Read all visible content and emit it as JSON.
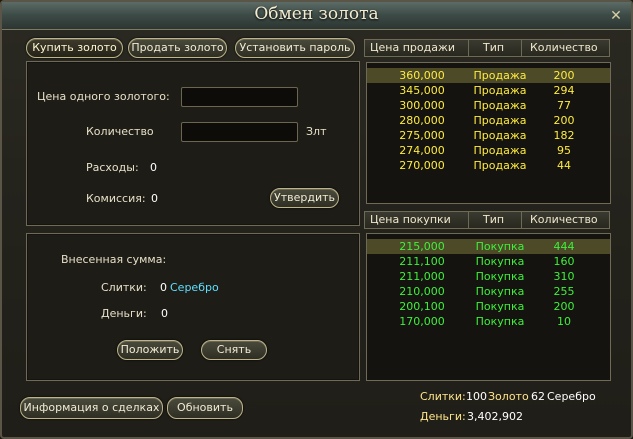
{
  "window": {
    "title": "Обмен золота",
    "close": "✕"
  },
  "tabs": {
    "buy": "Купить золото",
    "sell": "Продать золото",
    "password": "Установить пароль"
  },
  "form": {
    "price_label": "Цена одного золотого:",
    "quantity_label": "Количество",
    "quantity_unit": "Злт",
    "expense_label": "Расходы:",
    "expense_value": "0",
    "commission_label": "Комиссия:",
    "commission_value": "0",
    "confirm_button": "Утвердить"
  },
  "deposit": {
    "title": "Внесенная сумма:",
    "ingots_label": "Слитки:",
    "ingots_value": "0",
    "ingots_unit": "Серебро",
    "money_label": "Деньги:",
    "money_value": "0",
    "put_button": "Положить",
    "take_button": "Снять"
  },
  "bottom_buttons": {
    "deals_info": "Информация о сделках",
    "refresh": "Обновить"
  },
  "sell_table": {
    "headers": {
      "price": "Цена продажи",
      "type": "Тип",
      "qty": "Количество"
    },
    "rows": [
      {
        "price": "360,000",
        "type": "Продажа",
        "qty": "200"
      },
      {
        "price": "345,000",
        "type": "Продажа",
        "qty": "294"
      },
      {
        "price": "300,000",
        "type": "Продажа",
        "qty": "77"
      },
      {
        "price": "280,000",
        "type": "Продажа",
        "qty": "200"
      },
      {
        "price": "275,000",
        "type": "Продажа",
        "qty": "182"
      },
      {
        "price": "274,000",
        "type": "Продажа",
        "qty": "95"
      },
      {
        "price": "270,000",
        "type": "Продажа",
        "qty": "44"
      }
    ]
  },
  "buy_table": {
    "headers": {
      "price": "Цена покупки",
      "type": "Тип",
      "qty": "Количество"
    },
    "rows": [
      {
        "price": "215,000",
        "type": "Покупка",
        "qty": "444"
      },
      {
        "price": "211,100",
        "type": "Покупка",
        "qty": "160"
      },
      {
        "price": "211,000",
        "type": "Покупка",
        "qty": "310"
      },
      {
        "price": "210,000",
        "type": "Покупка",
        "qty": "255"
      },
      {
        "price": "200,100",
        "type": "Покупка",
        "qty": "200"
      },
      {
        "price": "170,000",
        "type": "Покупка",
        "qty": "10"
      }
    ]
  },
  "balance": {
    "ingots_label": "Слитки:",
    "ingots_value": "100",
    "gold_label": "Золото",
    "gold_value": "62",
    "silver_label": "Серебро",
    "money_label": "Деньги:",
    "money_value": "3,402,902"
  },
  "colors": {
    "sell_text": "#ffec3c",
    "buy_text": "#3ef03a",
    "silver_text": "#5ee0ff",
    "selected_row": "#4d4a28"
  }
}
